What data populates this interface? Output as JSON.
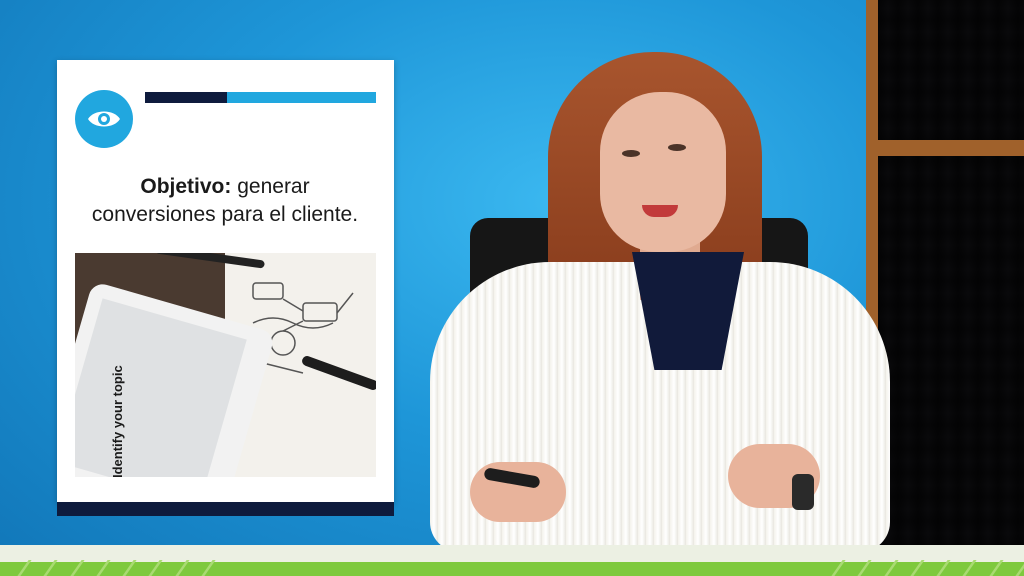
{
  "slide": {
    "objective_label": "Objetivo:",
    "objective_line1": " generar",
    "objective_line2": "conversiones para el cliente.",
    "photo_tablet_text": "Identify your topic"
  },
  "icons": {
    "badge": "eye-icon"
  },
  "colors": {
    "accent_light": "#21a7df",
    "accent_dark": "#0e1b3d",
    "stripe_green": "#7ec93d",
    "background_blue": "#1e96d8"
  }
}
